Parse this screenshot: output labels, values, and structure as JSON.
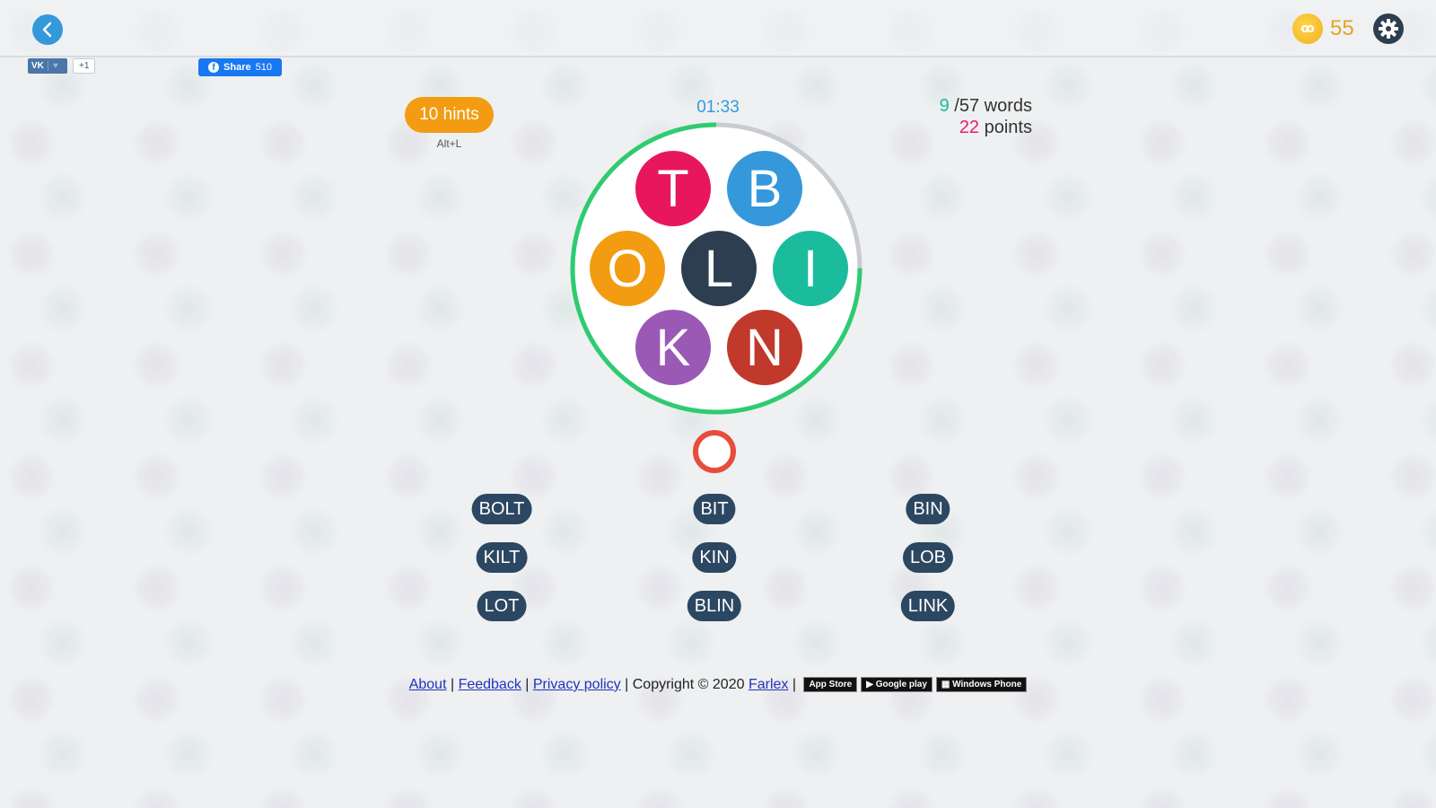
{
  "header": {
    "back_icon": "chevron-left-icon",
    "coins": "55",
    "coin_icon": "coin-icon",
    "settings_icon": "gear-icon"
  },
  "social": {
    "vk_logo": "VK",
    "vk_like_icon": "heart-icon",
    "vk_count": "+1",
    "fb_label": "Share",
    "fb_count": "510"
  },
  "game": {
    "hints_label": "10 hints",
    "hints_shortcut": "Alt+L",
    "timer": "01:33",
    "timer_remaining_fraction": 0.75,
    "words_found": "9",
    "words_total": "/57 words",
    "points_value": "22",
    "points_label": " points",
    "colors": {
      "timer_progress": "#2ecc71",
      "timer_track": "#c8ccd0",
      "current_word_ring": "#e74c3c",
      "word_pill": "#2c4761",
      "hints": "#f39c12"
    },
    "tiles": [
      {
        "letter": "T",
        "color": "#e8175d"
      },
      {
        "letter": "B",
        "color": "#3498db"
      },
      {
        "letter": "O",
        "color": "#f39c12"
      },
      {
        "letter": "L",
        "color": "#2c3e50"
      },
      {
        "letter": "I",
        "color": "#1abc9c"
      },
      {
        "letter": "K",
        "color": "#9b59b6"
      },
      {
        "letter": "N",
        "color": "#c0392b"
      }
    ],
    "current_word": "",
    "found_words": [
      [
        "BOLT",
        "BIT",
        "BIN"
      ],
      [
        "KILT",
        "KIN",
        "LOB"
      ],
      [
        "LOT",
        "BLIN",
        "LINK"
      ]
    ]
  },
  "footer": {
    "about": "About",
    "feedback": "Feedback",
    "privacy": "Privacy policy",
    "sep": " | ",
    "copyright": "Copyright © 2020 ",
    "farlex": "Farlex",
    "app_store": " App Store",
    "google_play": "▶ Google play",
    "windows_phone": "▦ Windows Phone"
  }
}
